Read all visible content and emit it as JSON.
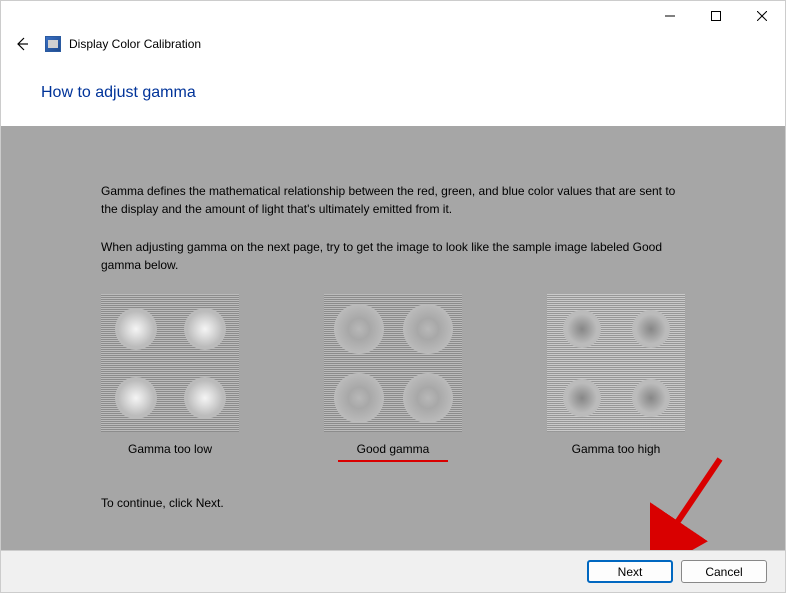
{
  "window": {
    "app_title": "Display Color Calibration",
    "page_title": "How to adjust gamma"
  },
  "content": {
    "paragraph1": "Gamma defines the mathematical relationship between the red, green, and blue color values that are sent to the display and the amount of light that's ultimately emitted from it.",
    "paragraph2": "When adjusting gamma on the next page, try to get the image to look like the sample image labeled Good gamma below.",
    "samples": {
      "low": "Gamma too low",
      "good": "Good gamma",
      "high": "Gamma too high"
    },
    "continue": "To continue, click Next."
  },
  "footer": {
    "next": "Next",
    "cancel": "Cancel"
  }
}
